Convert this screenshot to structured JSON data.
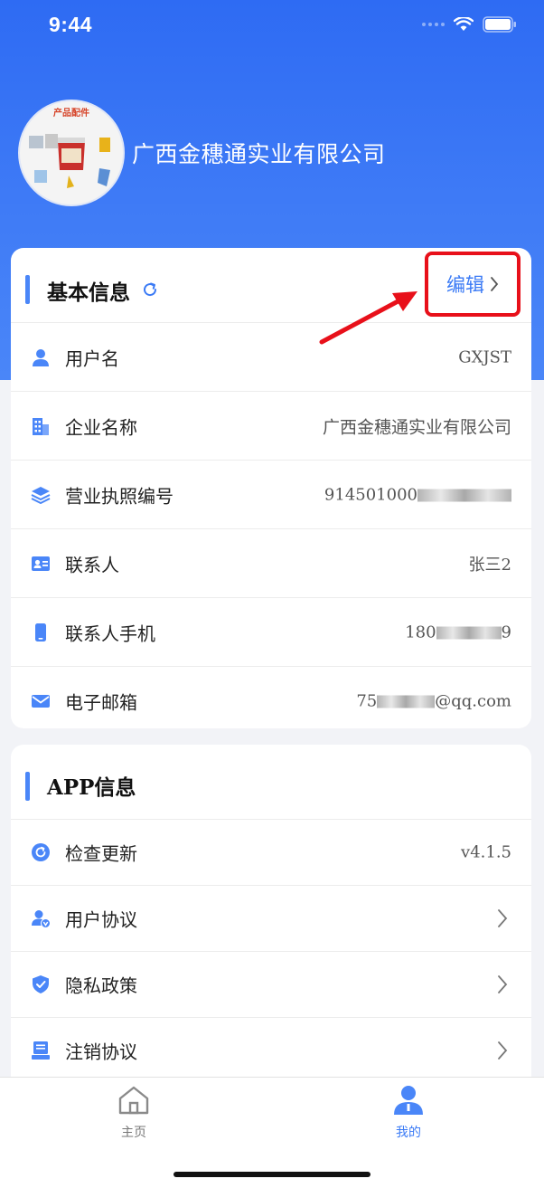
{
  "status_bar": {
    "time": "9:44"
  },
  "profile": {
    "company_name": "广西金穗通实业有限公司",
    "avatar_label": "产品配件"
  },
  "basic_info": {
    "title": "基本信息",
    "edit_label": "编辑",
    "rows": [
      {
        "label": "用户名",
        "value": "GXJST",
        "icon": "user-icon"
      },
      {
        "label": "企业名称",
        "value": "广西金穗通实业有限公司",
        "icon": "building-icon"
      },
      {
        "label": "营业执照编号",
        "value": "914501000",
        "icon": "layers-icon"
      },
      {
        "label": "联系人",
        "value": "张三2",
        "icon": "contact-card-icon"
      },
      {
        "label": "联系人手机",
        "value": "180",
        "value_suffix": "9",
        "icon": "phone-icon"
      },
      {
        "label": "电子邮箱",
        "value": "75",
        "value_suffix": "@qq.com",
        "icon": "mail-icon"
      }
    ]
  },
  "app_info": {
    "title": "APP信息",
    "rows": [
      {
        "label": "检查更新",
        "value": "v4.1.5",
        "icon": "refresh-circle-icon"
      },
      {
        "label": "用户协议",
        "icon": "user-agreement-icon"
      },
      {
        "label": "隐私政策",
        "icon": "shield-icon"
      },
      {
        "label": "注销协议",
        "icon": "document-icon"
      }
    ]
  },
  "tabbar": {
    "home_label": "主页",
    "mine_label": "我的"
  },
  "colors": {
    "accent": "#3a7af5",
    "header_blue": "#2e6bf3",
    "highlight_red": "#e8101a"
  }
}
